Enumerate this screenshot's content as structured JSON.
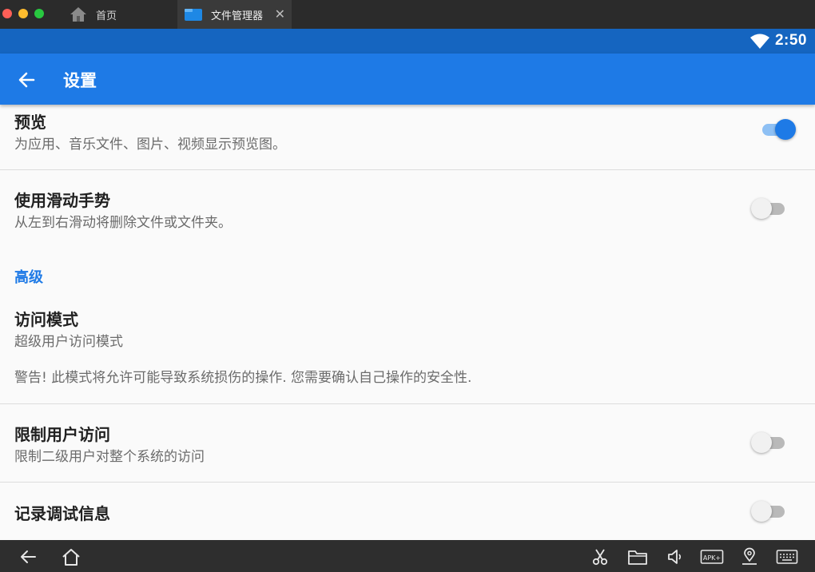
{
  "window": {
    "tabs": [
      {
        "label": "首页",
        "icon": "home-icon"
      },
      {
        "label": "文件管理器",
        "icon": "folder-icon",
        "close": "✕"
      }
    ]
  },
  "status_bar": {
    "time": "2:50",
    "icon": "wifi-icon"
  },
  "app_bar": {
    "title": "设置",
    "back_icon": "arrow-back-icon"
  },
  "settings": {
    "preview": {
      "title": "预览",
      "summary": "为应用、音乐文件、图片、视频显示预览图。",
      "enabled": true
    },
    "swipe": {
      "title": "使用滑动手势",
      "summary": "从左到右滑动将删除文件或文件夹。",
      "enabled": false
    },
    "advanced_header": "高级",
    "access_mode": {
      "title": "访问模式",
      "summary": "超级用户访问模式",
      "warning": "警告! 此模式将允许可能导致系统损伤的操作. 您需要确认自己操作的安全性."
    },
    "restrict_access": {
      "title": "限制用户访问",
      "summary": "限制二级用户对整个系统的访问",
      "enabled": false
    },
    "debug_log": {
      "title": "记录调试信息",
      "enabled": false
    }
  },
  "bottom_bar": {
    "icons": [
      "back-icon",
      "home-icon",
      "scissors-icon",
      "folder-icon",
      "volume-icon",
      "apk-install-icon",
      "location-icon",
      "keyboard-icon"
    ],
    "apk_label": "APK+"
  },
  "colors": {
    "accent": "#1e7ae6",
    "status_bar": "#1565c0"
  }
}
